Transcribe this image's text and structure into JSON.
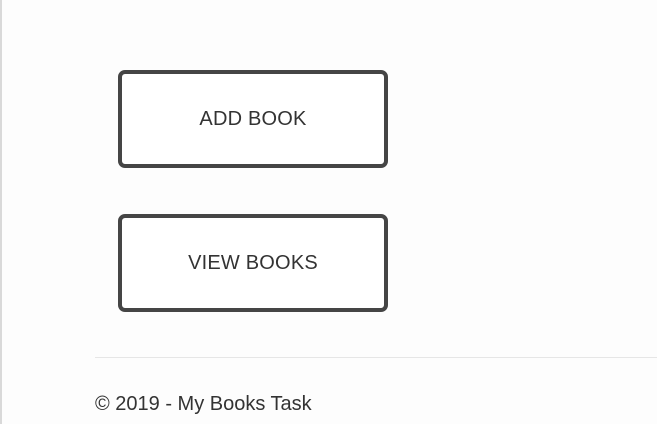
{
  "buttons": {
    "add_book": "ADD BOOK",
    "view_books": "VIEW BOOKS"
  },
  "footer": {
    "copyright": "© 2019 - My Books Task"
  },
  "colors": {
    "button_border": "#454545",
    "text": "#333333",
    "divider": "#e6e6e6",
    "background": "#fdfdfd"
  }
}
